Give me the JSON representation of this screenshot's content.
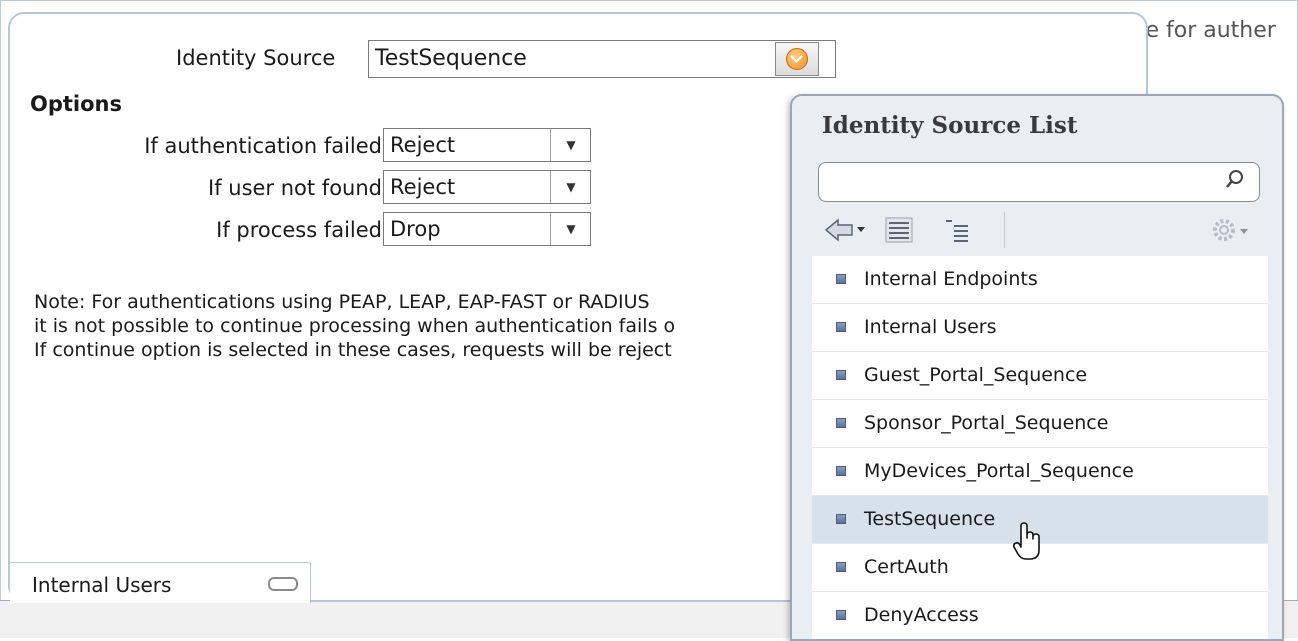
{
  "background": {
    "partial_text": "se for auther"
  },
  "identity_source": {
    "label": "Identity Source",
    "value": "TestSequence"
  },
  "options": {
    "title": "Options",
    "rows": [
      {
        "label": "If authentication failed",
        "value": "Reject"
      },
      {
        "label": "If user not found",
        "value": "Reject"
      },
      {
        "label": "If process failed",
        "value": "Drop"
      }
    ]
  },
  "note": {
    "line1": "Note: For authentications using PEAP, LEAP, EAP-FAST or RADIUS",
    "line2": "it is not possible to continue processing when authentication fails o",
    "line3": "If continue option is selected in these cases, requests will be reject"
  },
  "bottom_tab": {
    "label": "Internal Users"
  },
  "popup": {
    "title": "Identity Source List",
    "search": {
      "value": "",
      "placeholder": ""
    },
    "toolbar": {
      "icons": [
        "back-arrow-icon",
        "list-view-icon",
        "tree-view-icon",
        "gear-icon"
      ]
    },
    "items": [
      {
        "label": "Internal Endpoints"
      },
      {
        "label": "Internal Users"
      },
      {
        "label": "Guest_Portal_Sequence"
      },
      {
        "label": "Sponsor_Portal_Sequence"
      },
      {
        "label": "MyDevices_Portal_Sequence"
      },
      {
        "label": "TestSequence",
        "selected": true
      },
      {
        "label": "CertAuth"
      },
      {
        "label": "DenyAccess"
      }
    ]
  },
  "colors": {
    "accent": "#f08a1a",
    "selected_row": "#d7e1ec",
    "panel_border": "#b7c6d9"
  }
}
